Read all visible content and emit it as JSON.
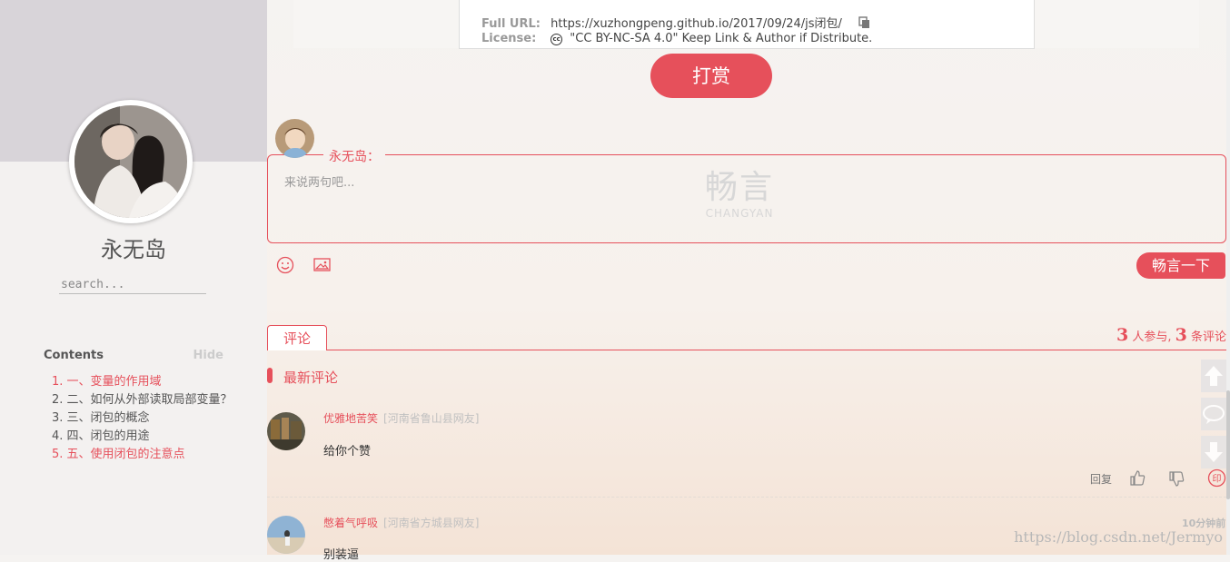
{
  "sidebar": {
    "site_name": "永无岛",
    "search_placeholder": "search...",
    "toc_title": "Contents",
    "toc_hide": "Hide",
    "toc_items": [
      {
        "label": "1. 一、变量的作用域",
        "state": "active"
      },
      {
        "label": "2. 二、如何从外部读取局部变量？",
        "state": "normal"
      },
      {
        "label": "3. 三、闭包的概念",
        "state": "normal"
      },
      {
        "label": "4. 四、闭包的用途",
        "state": "normal"
      },
      {
        "label": "5. 五、使用闭包的注意点",
        "state": "active"
      }
    ]
  },
  "post_meta": {
    "full_url_key": "Full URL:",
    "full_url_value": "https://xuzhongpeng.github.io/2017/09/24/js闭包/",
    "license_key": "License:",
    "license_value": "\"CC BY-NC-SA 4.0\" Keep Link & Author if Distribute."
  },
  "reward_button": "打赏",
  "compose": {
    "username": "永无岛：",
    "placeholder": "来说两句吧...",
    "watermark_cn": "畅言",
    "watermark_en": "CHANGYAN",
    "submit_label": "畅言一下"
  },
  "comments_section": {
    "tab_label": "评论",
    "participants": "3",
    "participants_label": "人参与,",
    "comment_count": "3",
    "comment_count_label": "条评论",
    "latest_title": "最新评论",
    "reply_label": "回复",
    "items": [
      {
        "username": "优雅地苦笑",
        "location": "[河南省鲁山县网友]",
        "text": "给你个赞",
        "time": ""
      },
      {
        "username": "憋着气呼吸",
        "location": "[河南省方城县网友]",
        "text": "别装逼",
        "time": "10分钟前"
      }
    ]
  },
  "watermark": "https://blog.csdn.net/Jermyo",
  "colors": {
    "accent": "#e6505b"
  }
}
